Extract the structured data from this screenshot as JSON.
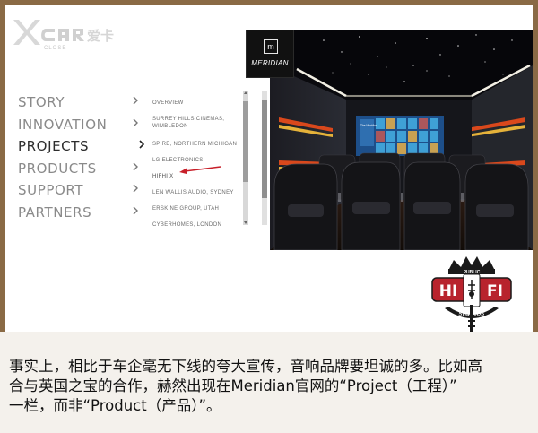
{
  "header": {
    "brand_logo": "XCAR爱卡",
    "brand_sub": "CLOSE"
  },
  "nav": {
    "items": [
      {
        "label": "STORY",
        "active": false
      },
      {
        "label": "INNOVATION",
        "active": false
      },
      {
        "label": "PROJECTS",
        "active": true
      },
      {
        "label": "PRODUCTS",
        "active": false
      },
      {
        "label": "SUPPORT",
        "active": false
      },
      {
        "label": "PARTNERS",
        "active": false
      }
    ]
  },
  "submenu": {
    "items": [
      {
        "label": "OVERVIEW"
      },
      {
        "label": "SURREY HILLS CINEMAS, WIMBLEDON"
      },
      {
        "label": "SPIRE, NORTHERN MICHIGAN"
      },
      {
        "label": "LG ELECTRONICS"
      },
      {
        "label": "HIFHI X"
      },
      {
        "label": "LEN WALLIS AUDIO, SYDNEY"
      },
      {
        "label": "ERSKINE GROUP, UTAH"
      },
      {
        "label": "CYBERHOMES, LONDON"
      }
    ],
    "highlighted_index": 4
  },
  "photo": {
    "brand": "MERIDIAN",
    "screen_title": "The Meridian"
  },
  "badge": {
    "top": "PUBLIC",
    "left": "HI",
    "right": "FI",
    "bottom": "studios"
  },
  "caption": {
    "lines": [
      "事实上，相比于车企毫无下线的夸大宣传，音响品牌要坦诚的多。比如高",
      "合与英国之宝的合作，赫然出现在Meridian官网的“Project（工程）”",
      "一栏，而非“Product（产品）”。"
    ]
  },
  "colors": {
    "frame": "#8a6a45",
    "accent_red": "#c8202a",
    "menu_inactive": "#8a8a8a",
    "menu_active": "#2d2d2d"
  }
}
